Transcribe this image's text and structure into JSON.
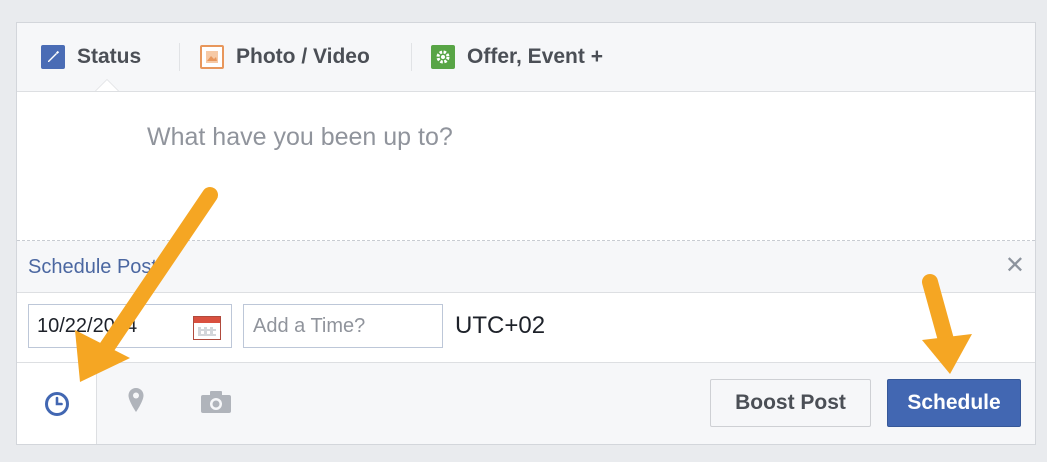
{
  "tabs": [
    {
      "label": "Status",
      "icon": "pencil-icon",
      "color": "#4a6cb5"
    },
    {
      "label": "Photo / Video",
      "icon": "photo-icon",
      "color": "#e8975c"
    },
    {
      "label": "Offer, Event +",
      "icon": "gear-icon",
      "color": "#58a546"
    }
  ],
  "composer": {
    "placeholder": "What have you been up to?"
  },
  "schedule": {
    "label": "Schedule Post",
    "close_glyph": "✕"
  },
  "date_time": {
    "date_value": "10/22/2014",
    "time_placeholder": "Add a Time?",
    "timezone": "UTC+02"
  },
  "bottom_bar": {
    "icons": [
      "clock-icon",
      "location-pin-icon",
      "camera-icon"
    ],
    "boost_label": "Boost Post",
    "schedule_label": "Schedule"
  },
  "colors": {
    "accent": "#4267b2",
    "annotation_arrow": "#f5a623"
  }
}
